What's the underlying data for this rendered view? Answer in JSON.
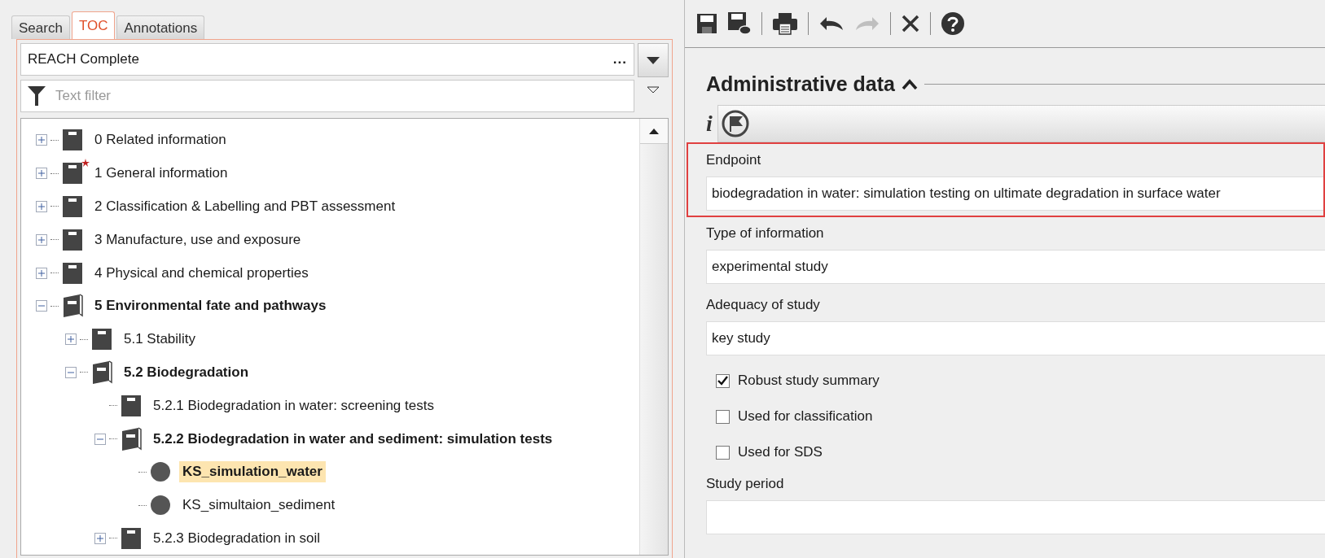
{
  "left_panel": {
    "tabs": [
      {
        "label": "Search",
        "selected": false
      },
      {
        "label": "TOC",
        "selected": true
      },
      {
        "label": "Annotations",
        "selected": false
      }
    ],
    "template_combo": {
      "value": "REACH Complete",
      "more": "..."
    },
    "filter": {
      "placeholder": "Text filter"
    },
    "tree": [
      {
        "label": "0 Related information",
        "kind": "section",
        "expanded": false,
        "flagged": false,
        "selected": false
      },
      {
        "label": "1 General information",
        "kind": "section",
        "expanded": false,
        "flagged": true,
        "selected": false
      },
      {
        "label": "2 Classification & Labelling and PBT assessment",
        "kind": "section",
        "expanded": false,
        "flagged": false,
        "selected": false
      },
      {
        "label": "3 Manufacture, use and exposure",
        "kind": "section",
        "expanded": false,
        "flagged": false,
        "selected": false
      },
      {
        "label": "4 Physical and chemical properties",
        "kind": "section",
        "expanded": false,
        "flagged": false,
        "selected": false
      },
      {
        "label": "5 Environmental fate and pathways",
        "kind": "section",
        "expanded": true,
        "flagged": false,
        "selected": false,
        "children": [
          {
            "label": "5.1 Stability",
            "kind": "section",
            "expanded": false,
            "flagged": false,
            "selected": false
          },
          {
            "label": "5.2 Biodegradation",
            "kind": "section",
            "expanded": true,
            "flagged": false,
            "selected": false,
            "children": [
              {
                "label": "5.2.1 Biodegradation in water: screening tests",
                "kind": "leaf-section",
                "flagged": false,
                "selected": false
              },
              {
                "label": "5.2.2 Biodegradation in water and sediment: simulation tests",
                "kind": "section",
                "expanded": true,
                "flagged": false,
                "selected": false,
                "children": [
                  {
                    "label": "KS_simulation_water",
                    "kind": "record",
                    "flagged": false,
                    "selected": true
                  },
                  {
                    "label": "KS_simultaion_sediment",
                    "kind": "record",
                    "flagged": false,
                    "selected": false
                  }
                ]
              },
              {
                "label": "5.2.3 Biodegradation in soil",
                "kind": "section",
                "expanded": false,
                "flagged": false,
                "selected": false
              }
            ]
          }
        ]
      }
    ]
  },
  "right_panel": {
    "toolbar": [
      {
        "kind": "save",
        "disabled": false
      },
      {
        "kind": "save-comment",
        "disabled": false
      },
      {
        "kind": "separator"
      },
      {
        "kind": "print",
        "disabled": false
      },
      {
        "kind": "separator"
      },
      {
        "kind": "undo",
        "disabled": false
      },
      {
        "kind": "redo",
        "disabled": true
      },
      {
        "kind": "separator"
      },
      {
        "kind": "delete",
        "disabled": false
      },
      {
        "kind": "separator"
      },
      {
        "kind": "help",
        "disabled": false
      }
    ],
    "section": {
      "title": "Administrative data",
      "expanded": true
    },
    "info_button": "i",
    "fields": [
      {
        "kind": "text",
        "label": "Endpoint",
        "value": "biodegradation in water: simulation testing on ultimate degradation in surface water",
        "highlighted": true
      },
      {
        "kind": "text",
        "label": "Type of information",
        "value": "experimental study",
        "highlighted": false
      },
      {
        "kind": "text",
        "label": "Adequacy of study",
        "value": "key study",
        "highlighted": false
      },
      {
        "kind": "check",
        "label": "Robust study summary",
        "checked": true
      },
      {
        "kind": "check",
        "label": "Used for classification",
        "checked": false
      },
      {
        "kind": "check",
        "label": "Used for SDS",
        "checked": false
      },
      {
        "kind": "text",
        "label": "Study period",
        "highlighted": false
      }
    ]
  }
}
